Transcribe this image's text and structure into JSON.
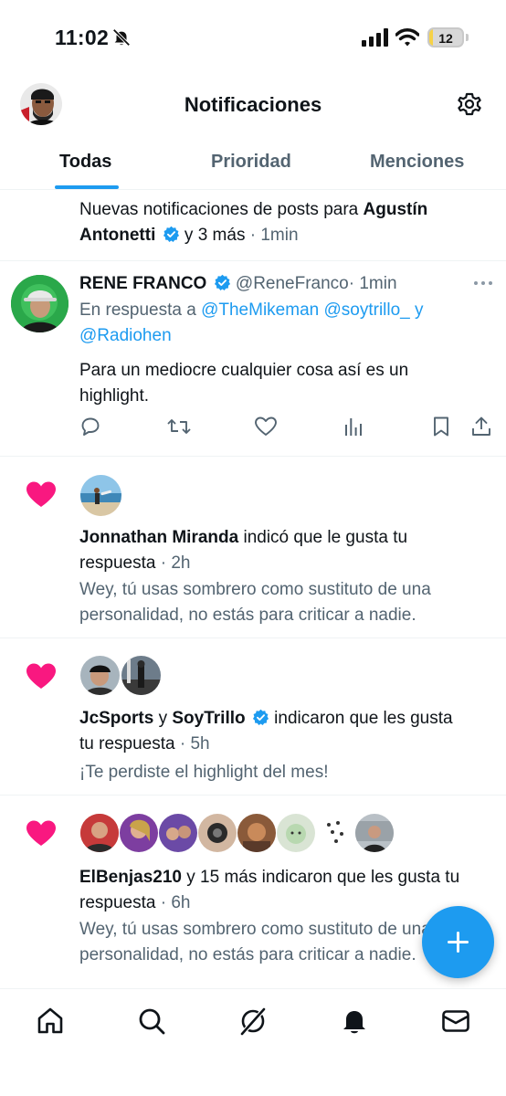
{
  "status_bar": {
    "time": "11:02",
    "battery_level": "12",
    "battery_fill_percent": 12,
    "icons": [
      "bell-off-icon",
      "signal-icon",
      "wifi-icon",
      "battery-icon"
    ]
  },
  "header": {
    "title": "Notificaciones",
    "icons": [
      "avatar",
      "gear-icon"
    ]
  },
  "tabs": [
    {
      "label": "Todas",
      "active": true
    },
    {
      "label": "Prioridad",
      "active": false
    },
    {
      "label": "Menciones",
      "active": false
    }
  ],
  "new_posts_notice": {
    "prefix": "Nuevas notificaciones de posts para ",
    "name_part1": "Agustín",
    "name_part2": "Antonetti",
    "suffix": " y 3 más",
    "time": "· 1min"
  },
  "reply_post": {
    "author_name": "RENE FRANCO",
    "handle": "@ReneFranco",
    "time": "· 1min",
    "reply_prefix": "En respuesta a ",
    "mention1": "@TheMikeman",
    "mention2": "@soytrillo_",
    "mention_joiner": "y",
    "mention3": "@Radiohen",
    "text_line1": "Para un mediocre cualquier cosa así es un",
    "text_line2": "highlight.",
    "action_icons": [
      "reply-icon",
      "retweet-icon",
      "like-icon",
      "views-icon",
      "bookmark-icon",
      "share-icon"
    ]
  },
  "likes": [
    {
      "actor": "Jonnathan Miranda",
      "verb": " indicó que le gusta tu",
      "line2": "respuesta",
      "time": "· 2h",
      "quote_line1": "Wey, tú usas sombrero como sustituto de una",
      "quote_line2": "personalidad, no estás para criticar a nadie."
    },
    {
      "actor1": "JcSports",
      "joiner": " y ",
      "actor2": "SoyTrillo",
      "verb": " indicaron que les gusta",
      "line2": "tu respuesta",
      "time": "· 5h",
      "quote_line1": "¡Te perdiste el highlight del mes!"
    },
    {
      "actor": "ElBenjas210",
      "verb": " y 15 más indicaron que les gusta tu",
      "line2": "respuesta",
      "time": "· 6h",
      "quote_line1": "Wey, tú usas sombrero como sustituto de una",
      "quote_line2": "personalidad, no estás para criticar a nadie."
    }
  ],
  "bottom_nav": [
    "home-icon",
    "search-icon",
    "grok-icon",
    "notifications-icon",
    "messages-icon"
  ],
  "colors": {
    "accent": "#1d9bf0",
    "heart": "#f91880",
    "text": "#0f1419",
    "muted": "#536471",
    "battery": "#f6d247"
  }
}
